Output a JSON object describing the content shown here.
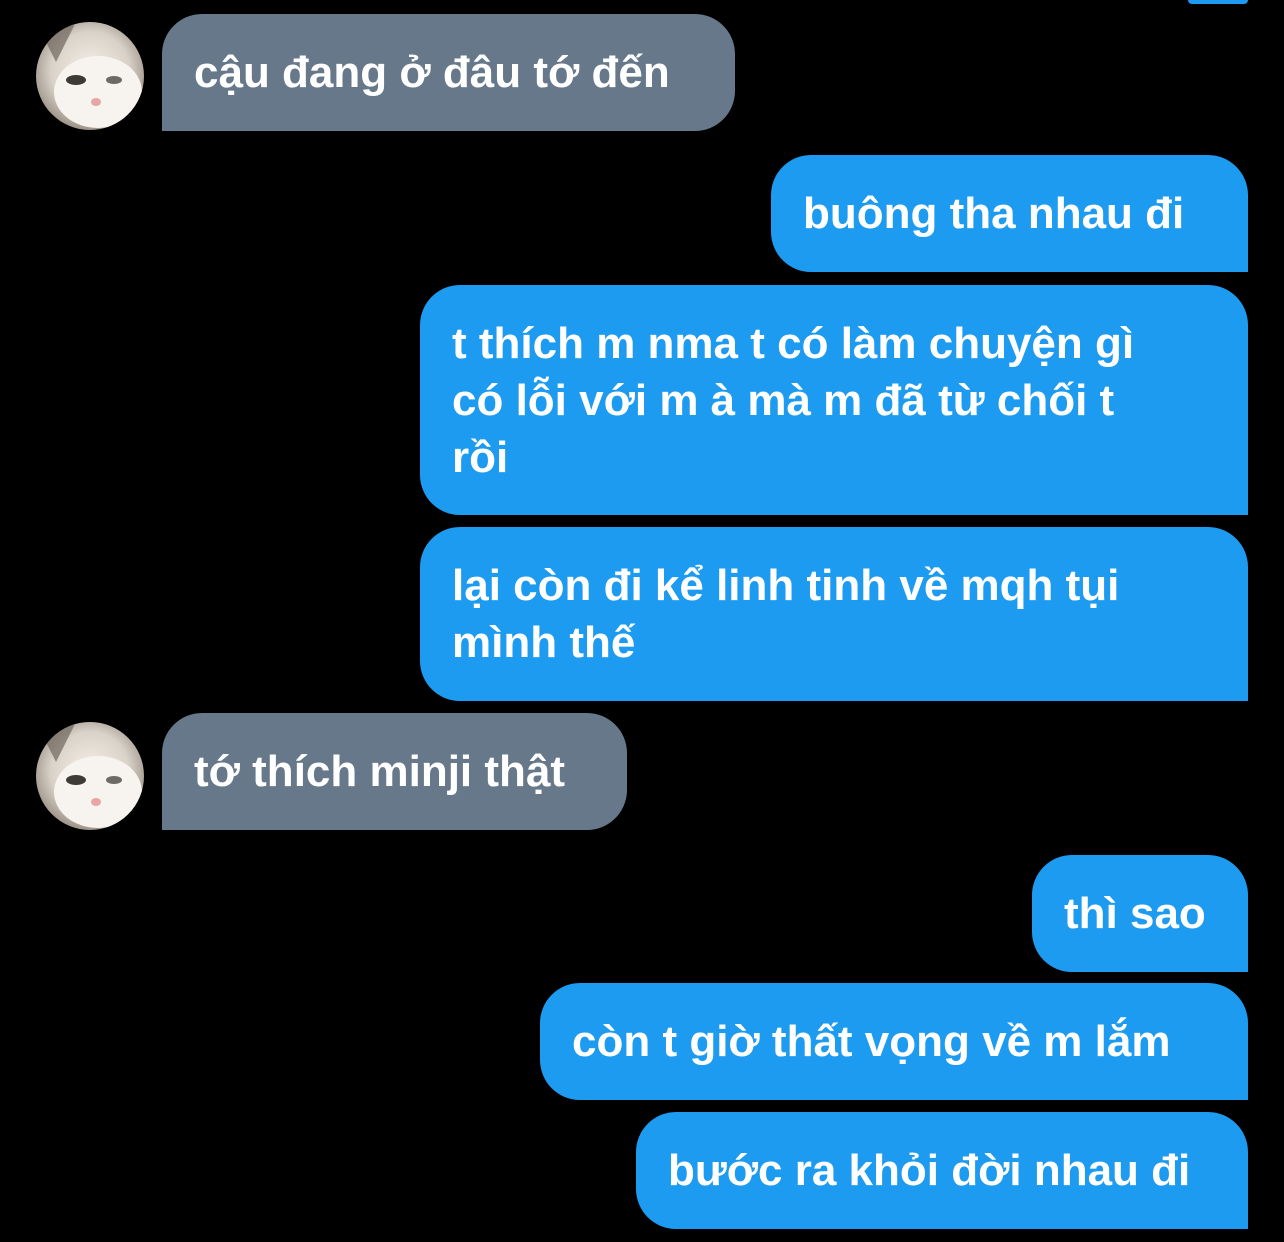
{
  "colors": {
    "background": "#000000",
    "incoming_bubble": "#66788a",
    "outgoing_bubble": "#1d9bf0",
    "text": "#ffffff"
  },
  "contact": {
    "avatar_icon": "cat-avatar-icon"
  },
  "messages": [
    {
      "direction": "incoming",
      "text": "cậu đang ở đâu tớ đến"
    },
    {
      "direction": "outgoing",
      "text": "buông tha nhau đi"
    },
    {
      "direction": "outgoing",
      "text": "t thích m nma t có làm chuyện gì\ncó lỗi với m à mà m đã từ chối t\nrồi"
    },
    {
      "direction": "outgoing",
      "text": "lại còn đi kể linh tinh về mqh tụi\nmình thế"
    },
    {
      "direction": "incoming",
      "text": "tớ thích minji thật"
    },
    {
      "direction": "outgoing",
      "text": "thì sao"
    },
    {
      "direction": "outgoing",
      "text": "còn t giờ thất vọng về m lắm"
    },
    {
      "direction": "outgoing",
      "text": "bước ra khỏi đời nhau đi"
    }
  ]
}
